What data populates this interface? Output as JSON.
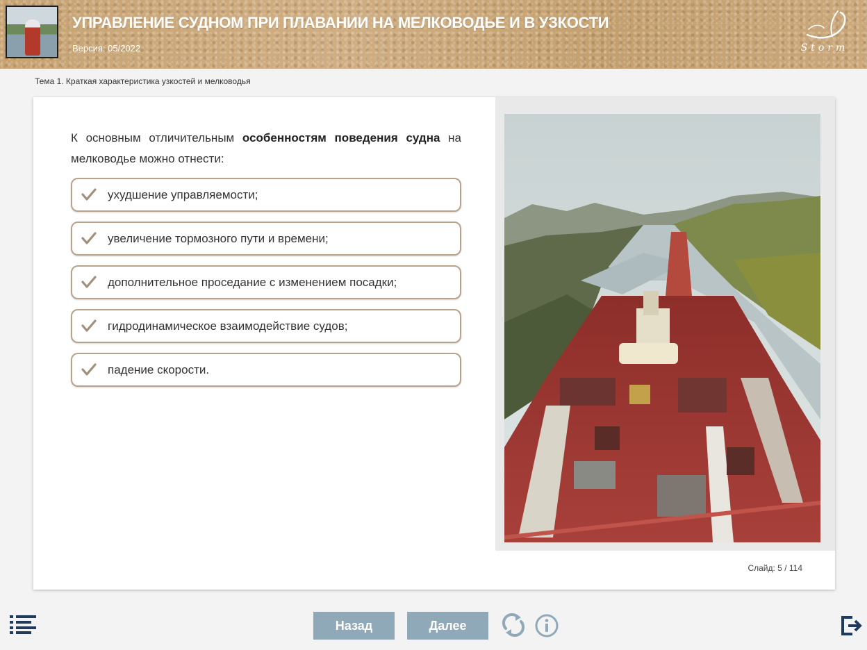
{
  "header": {
    "title": "УПРАВЛЕНИЕ СУДНОМ ПРИ ПЛАВАНИИ НА МЕЛКОВОДЬЕ И В УЗКОСТИ",
    "version": "Версия: 05/2022",
    "logo_text": "Storm"
  },
  "breadcrumb": "Тема 1. Краткая характеристика узкостей и мелководья",
  "slide": {
    "intro_before": "К основным отличительным ",
    "intro_bold": "особенностям поведения судна",
    "intro_after": " на мелководье можно отнести:",
    "items": [
      "ухудшение управляемости;",
      "увеличение тормозного пути и времени;",
      "дополнительное проседание с изменением посадки;",
      "гидродинамическое взаимодействие судов;",
      "падение скорости."
    ],
    "counter": "Слайд:  5 / 114"
  },
  "nav": {
    "back_label": "Назад",
    "next_label": "Далее"
  },
  "icons": {
    "menu": "list-menu-icon",
    "reload": "reload-icon",
    "info": "info-icon",
    "exit": "exit-icon",
    "check": "check-icon"
  },
  "colors": {
    "header_bg": "#c9a679",
    "item_border": "#b7a38a",
    "check": "#a08f7b",
    "nav_button": "#8fa9b9",
    "icon_dark": "#1f3a5a",
    "icon_light": "#8fa9b9"
  }
}
